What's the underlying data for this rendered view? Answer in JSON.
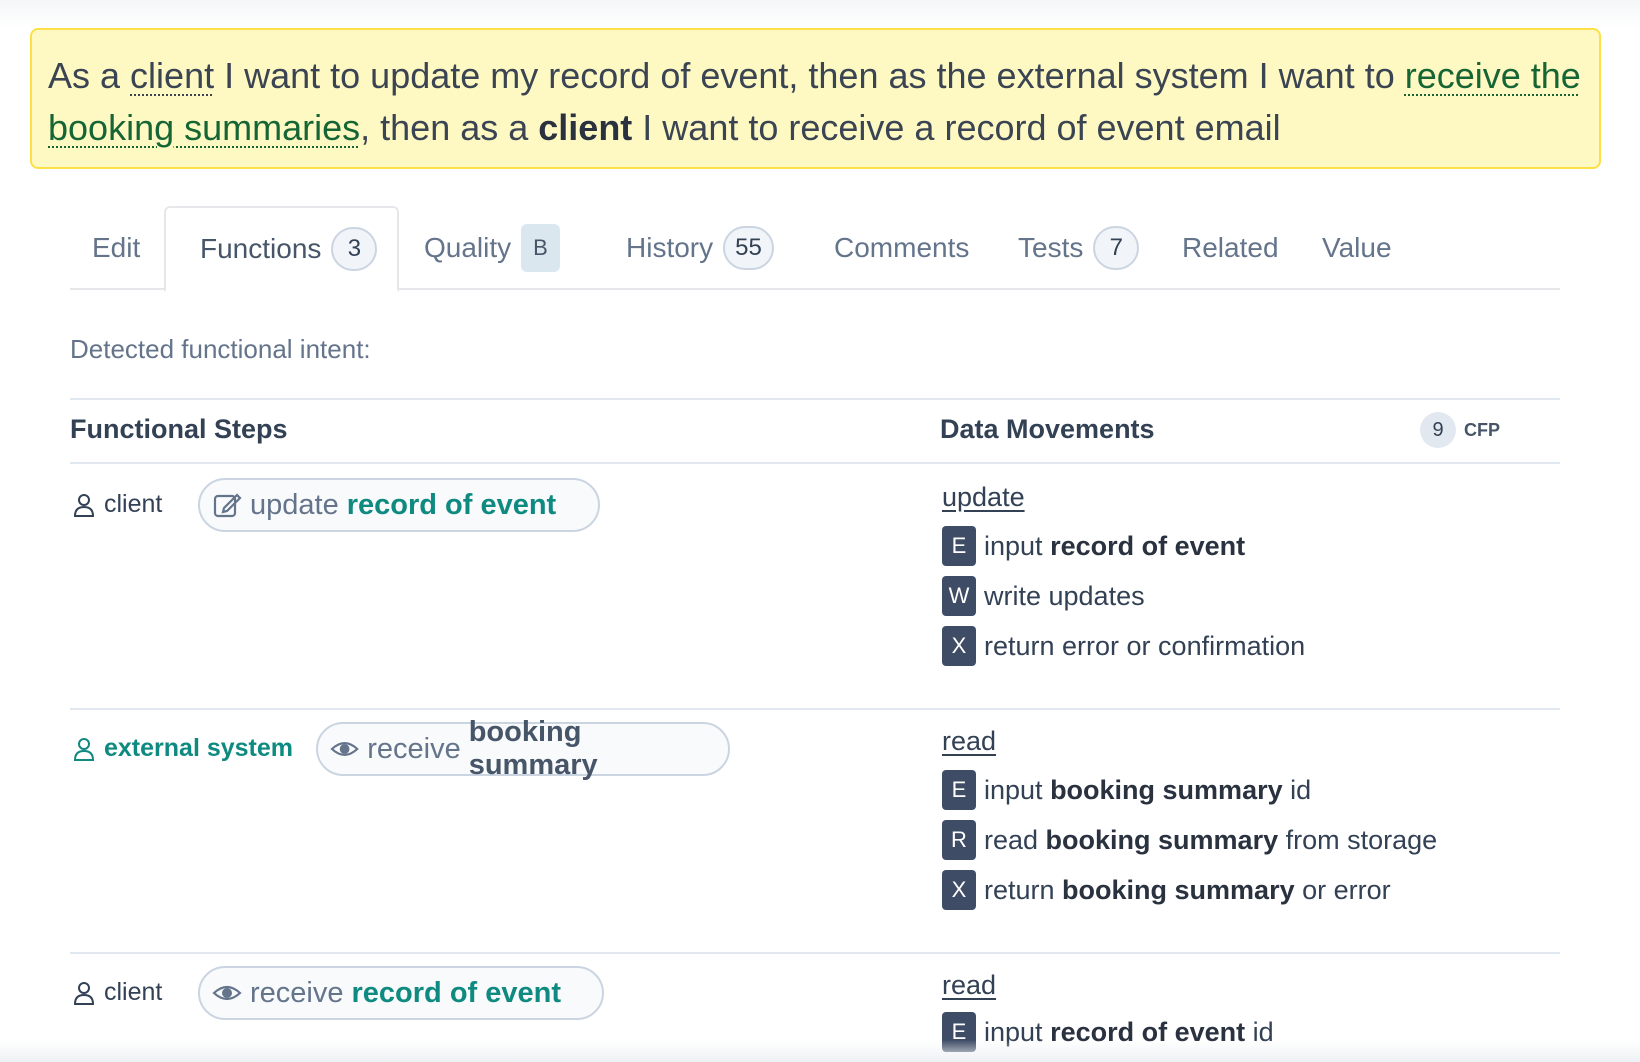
{
  "story": {
    "p1": "As a ",
    "actor1": "client",
    "p2": " I want to update my record of event, then as the external system I want to ",
    "goal": "receive the booking summaries",
    "p3": ", then as a ",
    "actor2": "client",
    "p4": " I want to receive a record of event email"
  },
  "tabs": [
    {
      "label": "Edit"
    },
    {
      "label": "Functions",
      "count": "3"
    },
    {
      "label": "Quality",
      "grade": "B"
    },
    {
      "label": "History",
      "count": "55"
    },
    {
      "label": "Comments"
    },
    {
      "label": "Tests",
      "count": "7"
    },
    {
      "label": "Related"
    },
    {
      "label": "Value"
    }
  ],
  "intent_label": "Detected functional intent:",
  "columns": {
    "steps": "Functional Steps",
    "movements": "Data Movements",
    "cfp_count": "9",
    "cfp_label": "CFP"
  },
  "steps": [
    {
      "actor": "client",
      "verb": "update",
      "object": "record of event",
      "movement_head": "update",
      "movements": [
        {
          "code": "E",
          "pre": "input ",
          "bold": "record of event",
          "post": ""
        },
        {
          "code": "W",
          "pre": "write updates",
          "bold": "",
          "post": ""
        },
        {
          "code": "X",
          "pre": "return error or confirmation",
          "bold": "",
          "post": ""
        }
      ]
    },
    {
      "actor": "external system",
      "verb": "receive",
      "object": "booking summary",
      "movement_head": "read",
      "movements": [
        {
          "code": "E",
          "pre": "input ",
          "bold": "booking summary",
          "post": " id"
        },
        {
          "code": "R",
          "pre": "read ",
          "bold": "booking summary",
          "post": " from storage"
        },
        {
          "code": "X",
          "pre": "return ",
          "bold": "booking summary",
          "post": " or error"
        }
      ]
    },
    {
      "actor": "client",
      "verb": "receive",
      "object": "record of event",
      "movement_head": "read",
      "movements": [
        {
          "code": "E",
          "pre": "input ",
          "bold": "record of event",
          "post": " id"
        }
      ]
    }
  ],
  "colors": {
    "story_bg": "#fef9c3",
    "story_border": "#fde047",
    "accent_teal": "#0f8a80",
    "badge_bg": "#3f4c66"
  },
  "icons": {
    "user": "user-icon",
    "edit": "edit-icon",
    "eye": "eye-icon"
  }
}
